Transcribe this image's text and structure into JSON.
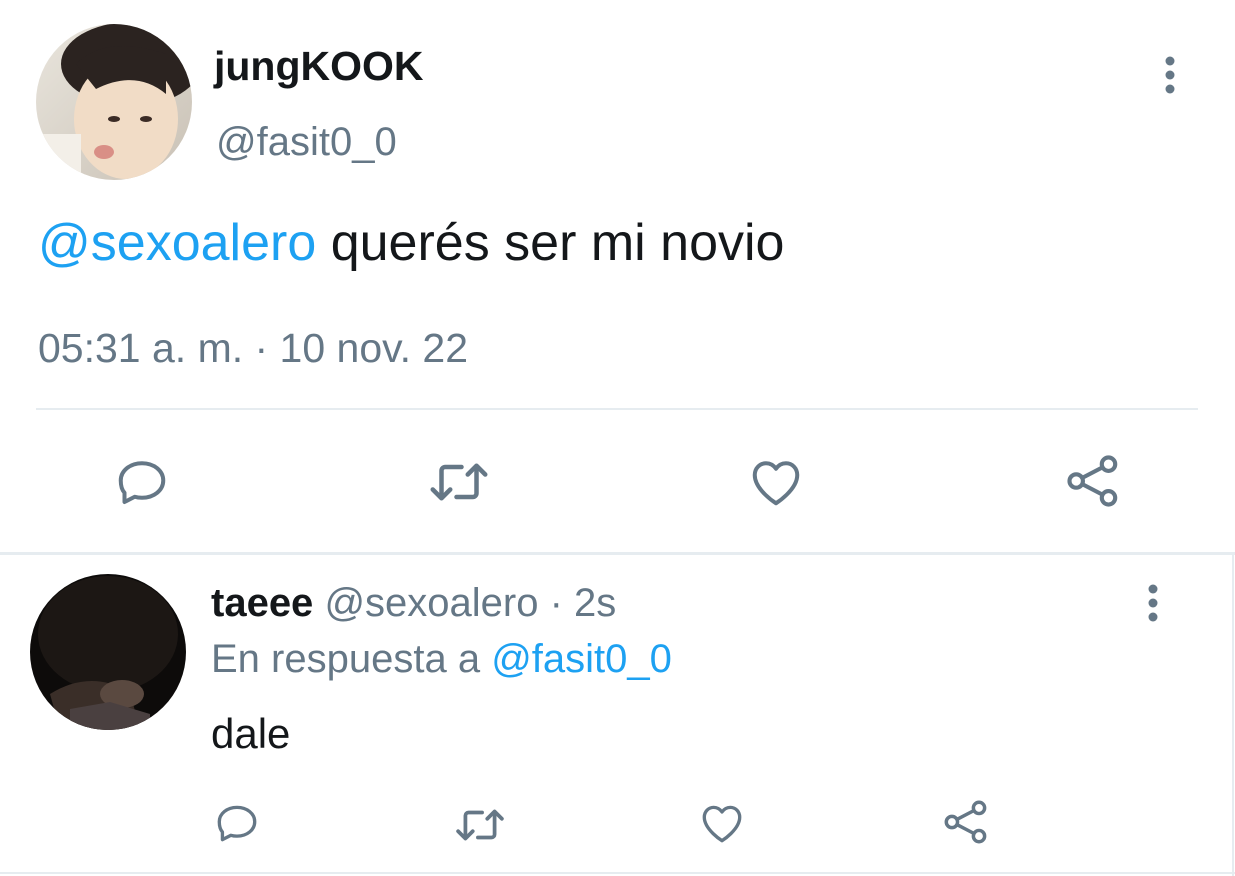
{
  "main_tweet": {
    "display_name": "jungKOOK",
    "handle": "@fasit0_0",
    "mention": "@sexoalero",
    "text": " querés ser mi novio",
    "timestamp": "05:31 a. m. · 10 nov. 22"
  },
  "reply": {
    "display_name": "taeee",
    "handle": "@sexoalero",
    "time": " · 2s",
    "reply_prefix": "En respuesta a ",
    "reply_to": "@fasit0_0",
    "text": "dale"
  },
  "colors": {
    "link": "#1da1f2",
    "secondary": "#657786",
    "icon": "#657786",
    "divider": "#e6ecf0"
  },
  "icons": [
    "reply-icon",
    "retweet-icon",
    "like-icon",
    "share-icon",
    "more-vertical-icon"
  ]
}
